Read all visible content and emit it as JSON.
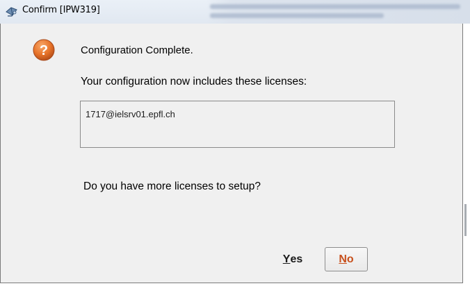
{
  "window": {
    "title": "Confirm [IPW319]",
    "icon": "app-icon"
  },
  "dialog": {
    "icon": "question-icon",
    "icon_glyph": "?",
    "heading": "Configuration Complete.",
    "subheading": "Your configuration now includes these licenses:",
    "licenses": [
      "1717@ielsrv01.epfl.ch"
    ],
    "question": "Do you have more licenses to setup?",
    "buttons": {
      "yes": {
        "mnemonic": "Y",
        "rest": "es"
      },
      "no": {
        "mnemonic": "N",
        "rest": "o"
      }
    }
  },
  "colors": {
    "dialog_bg": "#f0f0f0",
    "icon_orange": "#e8742a",
    "no_accent": "#c8501c"
  }
}
